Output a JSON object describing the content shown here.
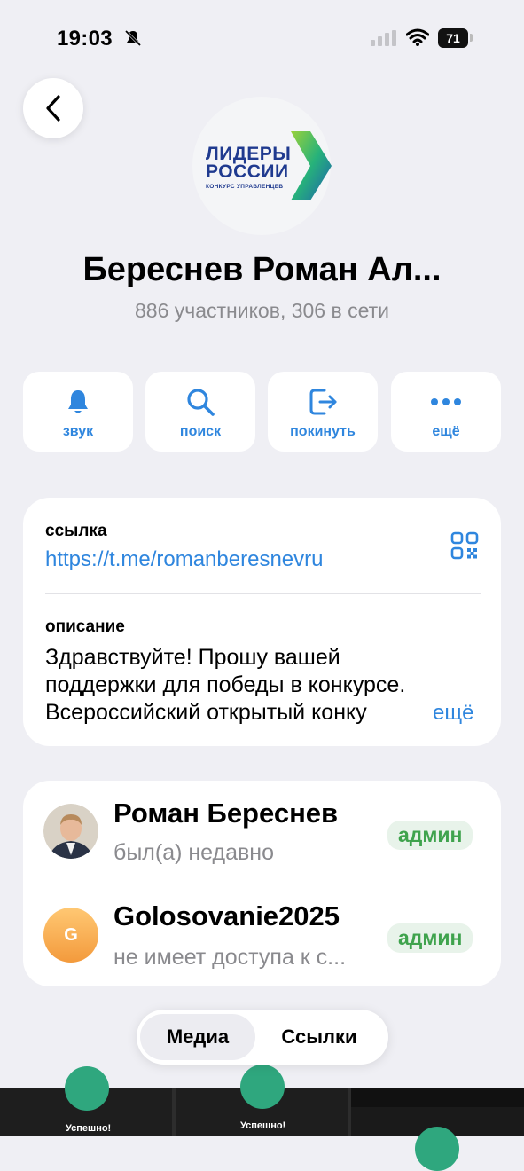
{
  "status_bar": {
    "time": "19:03",
    "battery": "71"
  },
  "header": {
    "logo_line1": "ЛИДЕРЫ",
    "logo_line2": "РОССИИ",
    "logo_line3": "КОНКУРС УПРАВЛЕНЦЕВ",
    "title": "Береснев Роман Ал...",
    "subtitle": "886 участников, 306 в сети"
  },
  "actions": [
    {
      "label": "звук",
      "icon": "bell-icon"
    },
    {
      "label": "поиск",
      "icon": "search-icon"
    },
    {
      "label": "покинуть",
      "icon": "leave-icon"
    },
    {
      "label": "ещё",
      "icon": "more-icon"
    }
  ],
  "info": {
    "link_label": "ссылка",
    "link_value": "https://t.me/romanberesnevru",
    "description_label": "описание",
    "description_lines": [
      "Здравствуйте! Прошу вашей",
      "поддержки для победы в конкурсе.",
      "Всероссийский открытый конку"
    ],
    "more_label": "ещё"
  },
  "members": [
    {
      "name": "Роман Береснев",
      "status": "был(а) недавно",
      "badge": "админ"
    },
    {
      "name": "Golosovanie2025",
      "status": "не имеет доступа к с...",
      "badge": "админ",
      "initial": "G"
    }
  ],
  "tabs": {
    "media": "Медиа",
    "links": "Ссылки"
  },
  "thumbs": [
    {
      "caption": "Успешно!"
    },
    {
      "caption": "Успешно!"
    }
  ],
  "colors": {
    "accent": "#2f86de",
    "admin_badge": "#3fa34d",
    "background": "#efeff4"
  }
}
